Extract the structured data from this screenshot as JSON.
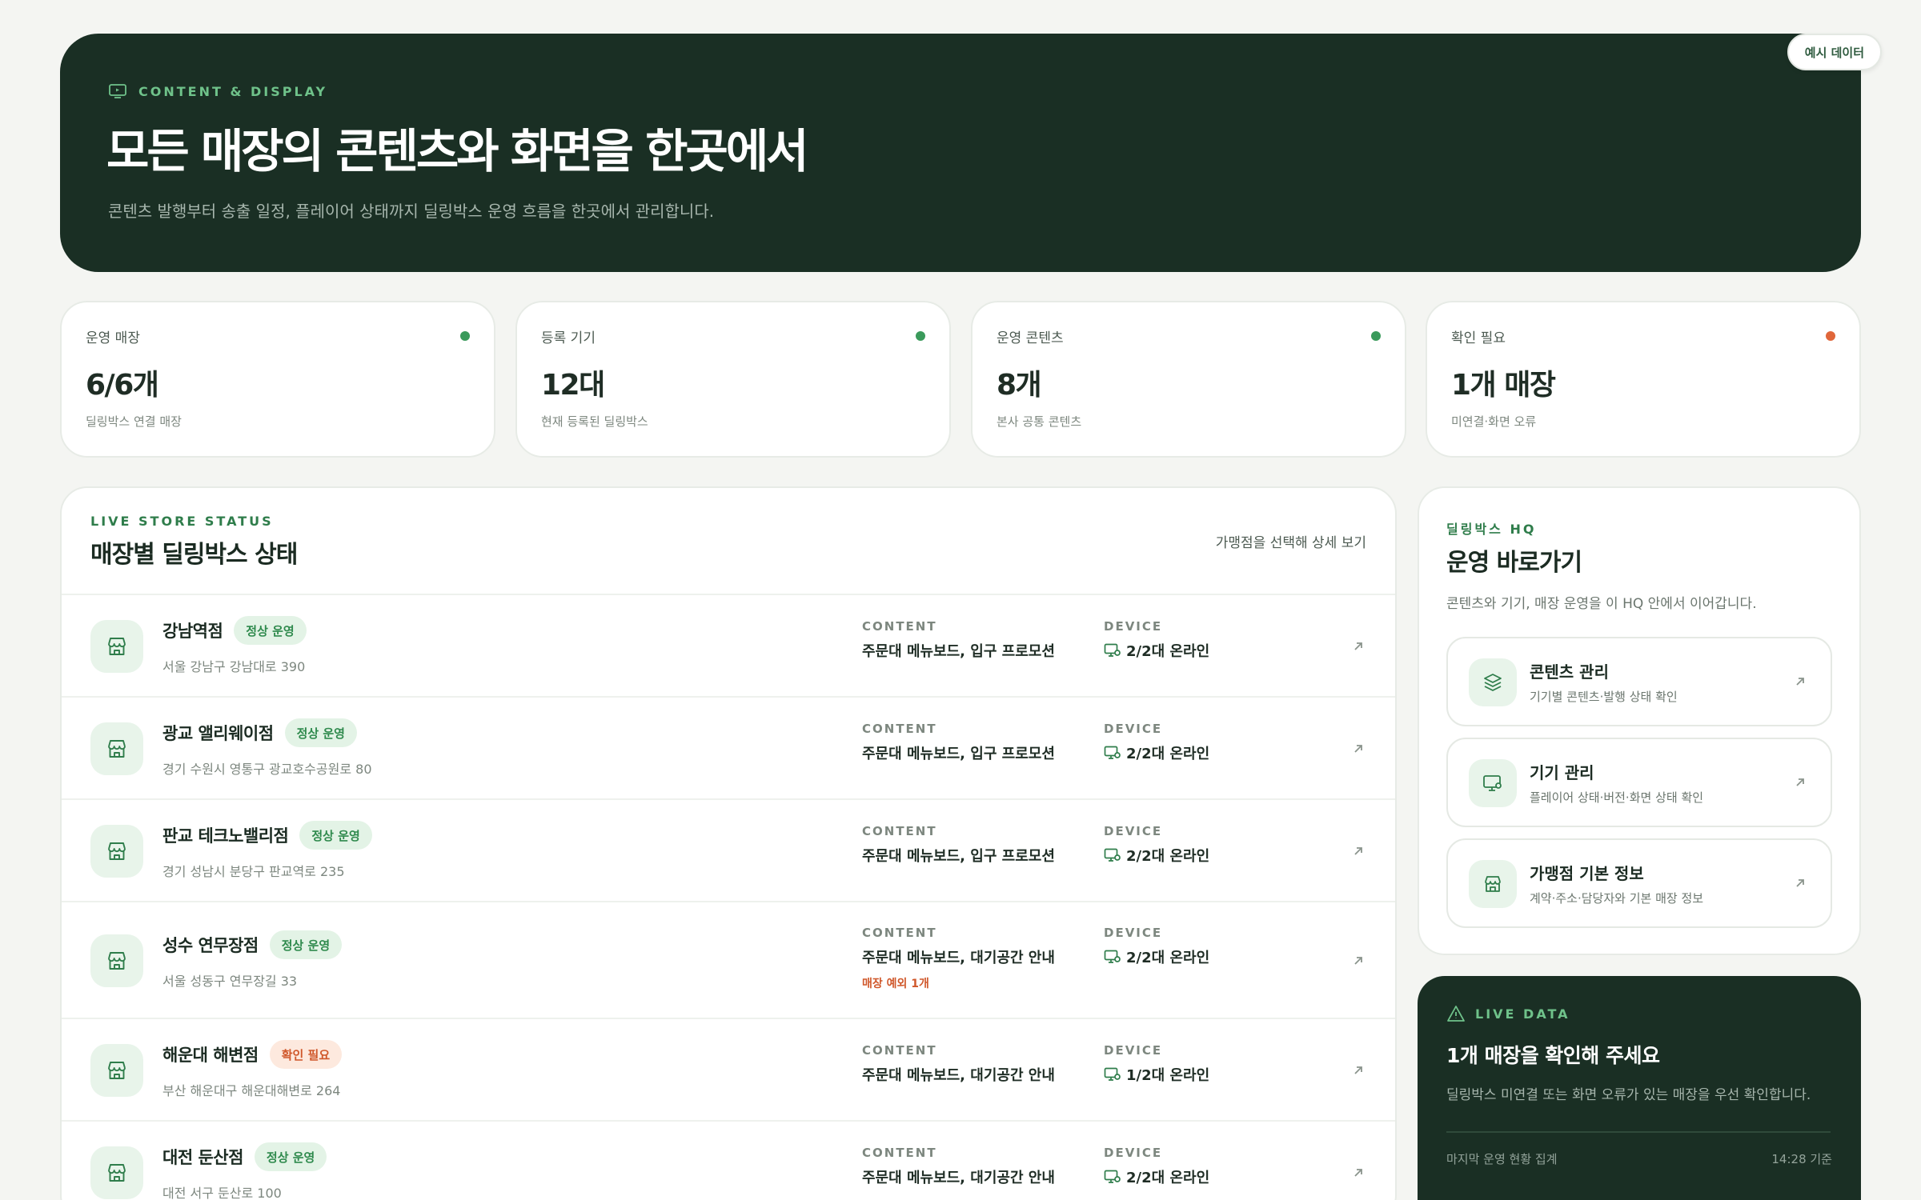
{
  "hero": {
    "eyebrow": "CONTENT & DISPLAY",
    "title": "모든 매장의 콘텐츠와 화면을 한곳에서",
    "description": "콘텐츠 발행부터 송출 일정, 플레이어 상태까지 딜링박스 운영 흐름을 한곳에서 관리합니다.",
    "sample_badge": "예시 데이터"
  },
  "stats": [
    {
      "label": "운영 매장",
      "value": "6/6개",
      "sub": "딜링박스 연결 매장",
      "dot_color": "#3a9a5b"
    },
    {
      "label": "등록 기기",
      "value": "12대",
      "sub": "현재 등록된 딜링박스",
      "dot_color": "#3a9a5b"
    },
    {
      "label": "운영 콘텐츠",
      "value": "8개",
      "sub": "본사 공통 콘텐츠",
      "dot_color": "#3a9a5b"
    },
    {
      "label": "확인 필요",
      "value": "1개 매장",
      "sub": "미연결·화면 오류",
      "dot_color": "#e0663a"
    }
  ],
  "store_status": {
    "eyebrow": "LIVE STORE STATUS",
    "title": "매장별 딜링박스 상태",
    "hint": "가맹점을 선택해 상세 보기",
    "content_label": "CONTENT",
    "device_label": "DEVICE",
    "stores": [
      {
        "name": "강남역점",
        "badge": "정상 운영",
        "status": "ok",
        "address": "서울 강남구 강남대로 390",
        "content": "주문대 메뉴보드, 입구 프로모션",
        "extra": "",
        "device": "2/2대 온라인"
      },
      {
        "name": "광교 앨리웨이점",
        "badge": "정상 운영",
        "status": "ok",
        "address": "경기 수원시 영통구 광교호수공원로 80",
        "content": "주문대 메뉴보드, 입구 프로모션",
        "extra": "",
        "device": "2/2대 온라인"
      },
      {
        "name": "판교 테크노밸리점",
        "badge": "정상 운영",
        "status": "ok",
        "address": "경기 성남시 분당구 판교역로 235",
        "content": "주문대 메뉴보드, 입구 프로모션",
        "extra": "",
        "device": "2/2대 온라인"
      },
      {
        "name": "성수 연무장점",
        "badge": "정상 운영",
        "status": "ok",
        "address": "서울 성동구 연무장길 33",
        "content": "주문대 메뉴보드, 대기공간 안내",
        "extra": "매장 예외 1개",
        "device": "2/2대 온라인"
      },
      {
        "name": "해운대 해변점",
        "badge": "확인 필요",
        "status": "warn",
        "address": "부산 해운대구 해운대해변로 264",
        "content": "주문대 메뉴보드, 대기공간 안내",
        "extra": "",
        "device": "1/2대 온라인"
      },
      {
        "name": "대전 둔산점",
        "badge": "정상 운영",
        "status": "ok",
        "address": "대전 서구 둔산로 100",
        "content": "주문대 메뉴보드, 대기공간 안내",
        "extra": "",
        "device": "2/2대 온라인"
      }
    ]
  },
  "hq": {
    "eyebrow": "딜링박스 HQ",
    "title": "운영 바로가기",
    "description": "콘텐츠와 기기, 매장 운영을 이 HQ 안에서 이어갑니다.",
    "items": [
      {
        "title": "콘텐츠 관리",
        "sub": "기기별 콘텐츠·발행 상태 확인",
        "icon": "layers-icon"
      },
      {
        "title": "기기 관리",
        "sub": "플레이어 상태·버전·화면 상태 확인",
        "icon": "monitor-icon"
      },
      {
        "title": "가맹점 기본 정보",
        "sub": "계약·주소·담당자와 기본 매장 정보",
        "icon": "store-icon"
      }
    ]
  },
  "live": {
    "eyebrow": "LIVE DATA",
    "title": "1개 매장을 확인해 주세요",
    "description": "딜링박스 미연결 또는 화면 오류가 있는 매장을 우선 확인합니다.",
    "foot_left": "마지막 운영 현황 집계",
    "foot_right": "14:28 기준"
  },
  "colors": {
    "brand_dark": "#1a2f24",
    "accent_green": "#6fc28a",
    "ok": "#2f8a4d",
    "warn": "#d0582b"
  }
}
